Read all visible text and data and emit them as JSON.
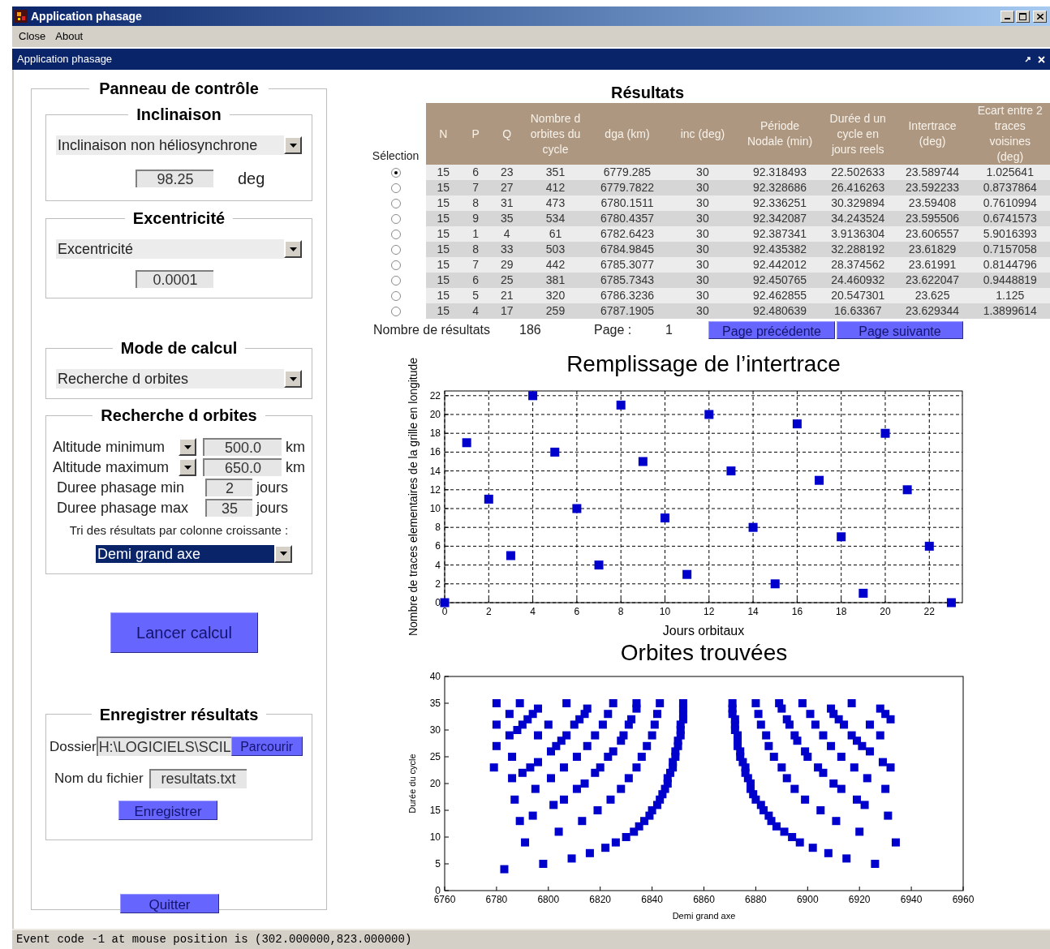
{
  "window": {
    "title": "Application phasage"
  },
  "menu": [
    "Close",
    "About"
  ],
  "inner_window": {
    "title": "Application phasage"
  },
  "control_panel": {
    "title": "Panneau de contrôle",
    "inclinaison": {
      "title": "Inclinaison",
      "dropdown": "Inclinaison non héliosynchrone",
      "value": "98.25",
      "unit": "deg"
    },
    "excentricite": {
      "title": "Excentricité",
      "dropdown": "Excentricité",
      "value": "0.0001"
    },
    "mode": {
      "title": "Mode de calcul",
      "dropdown": "Recherche d orbites"
    },
    "search": {
      "title": "Recherche d orbites",
      "rows": [
        {
          "kind": "dropdown-field",
          "label": "Altitude minimum",
          "value": "500.0",
          "unit": "km"
        },
        {
          "kind": "dropdown-field",
          "label": "Altitude maximum",
          "value": "650.0",
          "unit": "km"
        },
        {
          "kind": "field",
          "label": "Duree phasage min",
          "value": "2",
          "unit": "jours"
        },
        {
          "kind": "field",
          "label": "Duree phasage max",
          "value": "35",
          "unit": "jours"
        }
      ],
      "sort_label": "Tri des résultats par colonne croissante :",
      "sort_dropdown": {
        "value": "Demi grand axe",
        "focused": true
      }
    },
    "run_button": "Lancer calcul",
    "save": {
      "title": "Enregistrer résultats",
      "folder_label": "Dossier",
      "folder": "H:\\LOGICIELS\\SCIL",
      "browse_button": "Parcourir",
      "file_label": "Nom du fichier",
      "file": "resultats.txt",
      "save_button": "Enregistrer"
    },
    "quit_button": "Quitter"
  },
  "results": {
    "title": "Résultats",
    "selection_label": "Sélection",
    "columns": [
      "N",
      "P",
      "Q",
      "Nombre d orbites du cycle",
      "dga (km)",
      "inc (deg)",
      "Période Nodale (min)",
      "Durée d un cycle en jours reels",
      "Intertrace (deg)",
      "Ecart entre 2 traces voisines (deg)"
    ],
    "rows": [
      {
        "selected": true,
        "cells": [
          "15",
          "6",
          "23",
          "351",
          "6779.285",
          "30",
          "92.318493",
          "22.502633",
          "23.589744",
          "1.025641"
        ]
      },
      {
        "selected": false,
        "cells": [
          "15",
          "7",
          "27",
          "412",
          "6779.7822",
          "30",
          "92.328686",
          "26.416263",
          "23.592233",
          "0.8737864"
        ]
      },
      {
        "selected": false,
        "cells": [
          "15",
          "8",
          "31",
          "473",
          "6780.1511",
          "30",
          "92.336251",
          "30.329894",
          "23.59408",
          "0.7610994"
        ]
      },
      {
        "selected": false,
        "cells": [
          "15",
          "9",
          "35",
          "534",
          "6780.4357",
          "30",
          "92.342087",
          "34.243524",
          "23.595506",
          "0.6741573"
        ]
      },
      {
        "selected": false,
        "cells": [
          "15",
          "1",
          "4",
          "61",
          "6782.6423",
          "30",
          "92.387341",
          "3.9136304",
          "23.606557",
          "5.9016393"
        ]
      },
      {
        "selected": false,
        "cells": [
          "15",
          "8",
          "33",
          "503",
          "6784.9845",
          "30",
          "92.435382",
          "32.288192",
          "23.61829",
          "0.7157058"
        ]
      },
      {
        "selected": false,
        "cells": [
          "15",
          "7",
          "29",
          "442",
          "6785.3077",
          "30",
          "92.442012",
          "28.374562",
          "23.61991",
          "0.8144796"
        ]
      },
      {
        "selected": false,
        "cells": [
          "15",
          "6",
          "25",
          "381",
          "6785.7343",
          "30",
          "92.450765",
          "24.460932",
          "23.622047",
          "0.9448819"
        ]
      },
      {
        "selected": false,
        "cells": [
          "15",
          "5",
          "21",
          "320",
          "6786.3236",
          "30",
          "92.462855",
          "20.547301",
          "23.625",
          "1.125"
        ]
      },
      {
        "selected": false,
        "cells": [
          "15",
          "4",
          "17",
          "259",
          "6787.1905",
          "30",
          "92.480639",
          "16.63367",
          "23.629344",
          "1.3899614"
        ]
      }
    ],
    "count_label": "Nombre de résultats",
    "count": "186",
    "page_label": "Page :",
    "page": "1",
    "buttons": [
      "Page précédente",
      "Page suivante"
    ]
  },
  "fill_chart": {
    "chart_data": {
      "type": "scatter",
      "title": "Remplissage de l’intertrace",
      "xlabel": "Jours orbitaux",
      "ylabel": "Nombre de traces elementaires de la grille en longitude",
      "x": [
        0,
        1,
        2,
        3,
        4,
        5,
        6,
        7,
        8,
        9,
        10,
        11,
        12,
        13,
        14,
        15,
        16,
        17,
        18,
        19,
        20,
        21,
        22,
        23
      ],
      "series": [
        {
          "color": "#0000cc",
          "values": [
            0,
            17,
            11,
            5,
            22,
            16,
            10,
            4,
            21,
            15,
            9,
            3,
            20,
            14,
            8,
            2,
            19,
            13,
            7,
            1,
            18,
            12,
            6,
            0
          ]
        }
      ],
      "xlim": [
        0,
        23.5
      ],
      "ylim": [
        0,
        22.5
      ],
      "grid": true,
      "xticks": [
        0,
        2,
        4,
        6,
        8,
        10,
        12,
        14,
        16,
        18,
        20,
        22
      ],
      "yticks": [
        0,
        2,
        4,
        6,
        8,
        10,
        12,
        14,
        16,
        18,
        20,
        22
      ]
    }
  },
  "orbits_chart": {
    "chart_data": {
      "type": "scatter",
      "title": "Orbites trouvées",
      "xlabel": "Demi grand axe",
      "ylabel": "Durée du cycle",
      "x": [
        6783,
        6798,
        6809,
        6816,
        6822,
        6826,
        6791,
        6830,
        6833,
        6804,
        6835,
        6837,
        6813,
        6789,
        6839,
        6794,
        6840,
        6819,
        6842,
        6802,
        6843,
        6824,
        6806,
        6787,
        6844,
        6845,
        6828,
        6811,
        6795,
        6846,
        6814,
        6846,
        6831,
        6801,
        6786,
        6847,
        6818,
        6790,
        6848,
        6834,
        6820,
        6806,
        6793,
        6779,
        6848,
        6796,
        6849,
        6836,
        6823,
        6811,
        6786,
        6849,
        6825,
        6801,
        6850,
        6838,
        6815,
        6803,
        6780,
        6850,
        6828,
        6805,
        6851,
        6840,
        6829,
        6818,
        6807,
        6796,
        6785,
        6851,
        6788,
        6851,
        6841,
        6831,
        6821,
        6810,
        6800,
        6790,
        6780,
        6852,
        6832,
        6812,
        6792,
        6852,
        6842,
        6823,
        6814,
        6794,
        6785,
        6852,
        6834,
        6815,
        6796,
        6852,
        6843,
        6834,
        6825,
        6807,
        6789,
        6780,
        6926,
        6915,
        6908,
        6902,
        6897,
        6934,
        6894,
        6891,
        6920,
        6888,
        6886,
        6911,
        6885,
        6931,
        6883,
        6905,
        6882,
        6922,
        6880,
        6899,
        6919,
        6879,
        6878,
        6895,
        6913,
        6930,
        6878,
        6910,
        6877,
        6892,
        6923,
        6876,
        6906,
        6876,
        6890,
        6904,
        6918,
        6932,
        6875,
        6929,
        6874,
        6887,
        6900,
        6913,
        6874,
        6899,
        6924,
        6873,
        6885,
        6909,
        6921,
        6873,
        6896,
        6919,
        6873,
        6884,
        6895,
        6906,
        6917,
        6928,
        6872,
        6872,
        6882,
        6893,
        6903,
        6914,
        6924,
        6872,
        6892,
        6912,
        6932,
        6871,
        6881,
        6901,
        6910,
        6930,
        6871,
        6890,
        6909,
        6928,
        6871,
        6880,
        6889,
        6898,
        6917
      ],
      "series": [
        {
          "color": "#0000cc",
          "values": [
            4,
            5,
            6,
            7,
            8,
            9,
            9,
            10,
            11,
            11,
            12,
            13,
            13,
            13,
            14,
            14,
            15,
            15,
            16,
            16,
            17,
            17,
            17,
            17,
            18,
            19,
            19,
            19,
            19,
            20,
            20,
            21,
            21,
            21,
            21,
            22,
            22,
            22,
            23,
            23,
            23,
            23,
            23,
            23,
            24,
            24,
            25,
            25,
            25,
            25,
            25,
            26,
            26,
            26,
            27,
            27,
            27,
            27,
            27,
            28,
            28,
            28,
            29,
            29,
            29,
            29,
            29,
            29,
            29,
            30,
            30,
            31,
            31,
            31,
            31,
            31,
            31,
            31,
            31,
            32,
            32,
            32,
            32,
            33,
            33,
            33,
            33,
            33,
            33,
            34,
            34,
            34,
            34,
            35,
            35,
            35,
            35,
            35,
            35,
            35,
            5,
            6,
            7,
            8,
            9,
            9,
            10,
            11,
            11,
            12,
            13,
            13,
            14,
            14,
            15,
            15,
            16,
            16,
            17,
            17,
            17,
            18,
            19,
            19,
            19,
            19,
            20,
            20,
            21,
            21,
            21,
            22,
            22,
            23,
            23,
            23,
            23,
            23,
            24,
            24,
            25,
            25,
            25,
            25,
            26,
            26,
            26,
            27,
            27,
            27,
            27,
            28,
            28,
            28,
            29,
            29,
            29,
            29,
            29,
            29,
            30,
            31,
            31,
            31,
            31,
            31,
            31,
            32,
            32,
            32,
            32,
            33,
            33,
            33,
            33,
            33,
            34,
            34,
            34,
            34,
            35,
            35,
            35,
            35,
            35
          ]
        }
      ],
      "xlim": [
        6760,
        6960
      ],
      "ylim": [
        0,
        40
      ],
      "xticks": [
        6760,
        6780,
        6800,
        6820,
        6840,
        6860,
        6880,
        6900,
        6920,
        6940,
        6960
      ],
      "yticks": [
        0,
        5,
        10,
        15,
        20,
        25,
        30,
        35,
        40
      ]
    }
  },
  "status_bar": "Event code -1 at mouse position is (302.000000,823.000000)"
}
